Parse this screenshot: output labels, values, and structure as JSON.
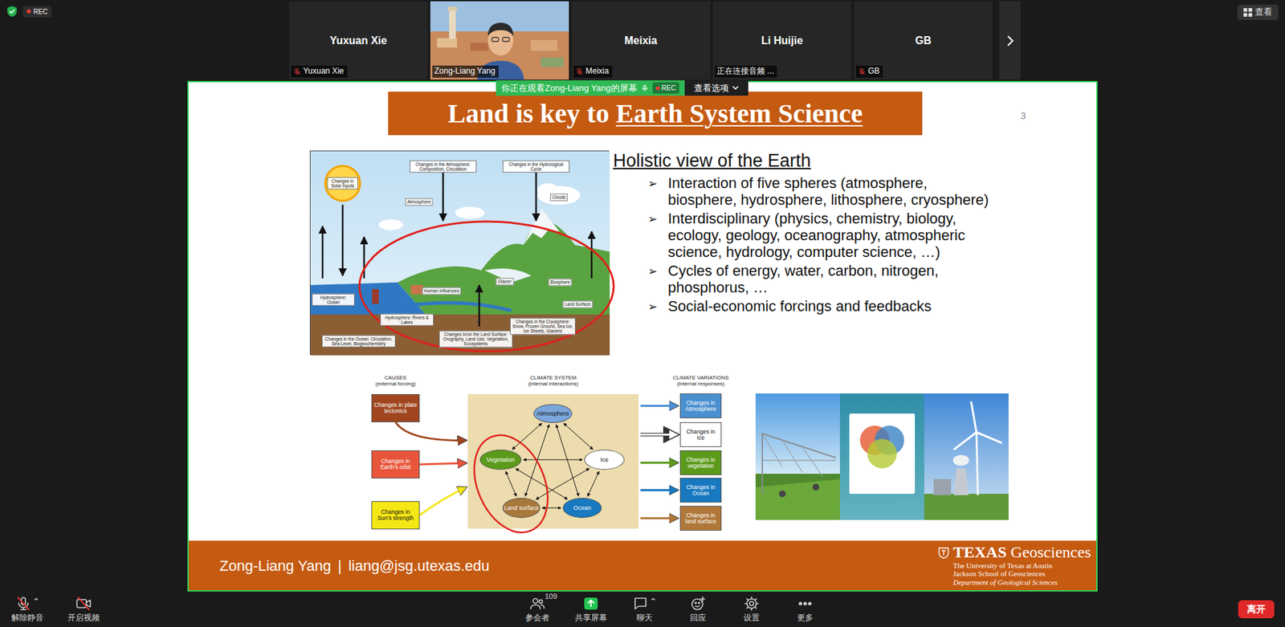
{
  "meeting": {
    "recording": "REC",
    "view_button": "查看"
  },
  "participants": [
    {
      "kind": "avatar",
      "name": "Yuxuan Xie",
      "label": "Yuxuan Xie",
      "muted": true,
      "speaking": false
    },
    {
      "kind": "video",
      "label": "Zong-Liang Yang",
      "muted": false,
      "speaking": true
    },
    {
      "kind": "avatar",
      "name": "Meixia",
      "label": "Meixia",
      "muted": true,
      "speaking": false
    },
    {
      "kind": "avatar",
      "name": "Li Huijie",
      "label": "正在连接音频 ...",
      "muted": false,
      "speaking": false
    },
    {
      "kind": "avatar",
      "name": "GB",
      "label": "GB",
      "muted": true,
      "speaking": false
    }
  ],
  "share_banner": {
    "text": "你正在观看Zong-Liang Yang的屏幕",
    "recording": "REC",
    "options": "查看选项"
  },
  "slide": {
    "title": "Land is key to",
    "title_link": "Earth System Science",
    "page": "3",
    "figure_labels": [
      "Changes in Solar Inputs",
      "Changes in the Atmosphere: Composition, Circulation",
      "Changes in the Hydrological Cycle",
      "Atmosphere",
      "Clouds",
      "Human Influences",
      "Glacier",
      "Biosphere",
      "Land Surface",
      "Hydrosphere: Ocean",
      "Hydrosphere: Rivers & Lakes",
      "Changes in the Ocean: Circulation, Sea Level, Biogeochemistry",
      "Changes in/on the Land Surface: Orography, Land Use, Vegetation, Ecosystems",
      "Changes in the Cryosphere: Snow, Frozen Ground, Sea Ice, Ice Sheets, Glaciers"
    ],
    "heading": "Holistic view of the Earth",
    "bullet_marker": "➢",
    "bullets": [
      "Interaction of five spheres (atmosphere, biosphere, hydrosphere, lithosphere, cryosphere)",
      "Interdisciplinary (physics, chemistry, biology, ecology, geology, oceanography, atmospheric science, hydrology, computer science, …)",
      "Cycles of energy, water, carbon, nitrogen, phosphorus, …",
      "Social-economic forcings and feedbacks"
    ]
  },
  "climate": {
    "causes_title": "CAUSES",
    "causes_subtitle": "(external forcing)",
    "causes": [
      {
        "label": "Changes in plate tectonics",
        "color": "#a0461f"
      },
      {
        "label": "Changes in Earth's orbit",
        "color": "#e8553a"
      },
      {
        "label": "Changes in Sun's strength",
        "color": "#f5e616"
      }
    ],
    "system_title": "CLIMATE SYSTEM",
    "system_subtitle": "(internal interactions)",
    "components": [
      {
        "label": "Atmosphere",
        "color": "#7aa6dc"
      },
      {
        "label": "Vegetation",
        "color": "#5c9a1b"
      },
      {
        "label": "Ice",
        "color": "#ffffff"
      },
      {
        "label": "Land surface",
        "color": "#a8773a"
      },
      {
        "label": "Ocean",
        "color": "#1878c0"
      }
    ],
    "variations_title": "CLIMATE VARIATIONS",
    "variations_subtitle": "(internal responses)",
    "variations": [
      {
        "label": "Changes in Atmosphere",
        "color": "#4a90d0"
      },
      {
        "label": "Changes in Ice",
        "color": "#ffffff"
      },
      {
        "label": "Changes in vegetation",
        "color": "#5c9a1b"
      },
      {
        "label": "Changes in Ocean",
        "color": "#1878c0"
      },
      {
        "label": "Changes in land surface",
        "color": "#b0773a"
      }
    ]
  },
  "footer": {
    "author": "Zong-Liang Yang",
    "separator": "|",
    "email": "liang@jsg.utexas.edu",
    "logo_bold": "TEXAS",
    "logo_rest": "Geosciences",
    "org_lines": [
      "The University of Texas at Austin",
      "Jackson School of Geosciences",
      "Department of Geological Sciences"
    ]
  },
  "toolbar": {
    "left": [
      {
        "kind": "mic",
        "label": "解除静音",
        "off": true,
        "caret": true
      },
      {
        "kind": "camera",
        "label": "开启视频",
        "off": true,
        "caret": false
      }
    ],
    "center": [
      {
        "kind": "participants",
        "label": "参会者",
        "count": "109",
        "caret": false
      },
      {
        "kind": "share",
        "label": "共享屏幕",
        "caret": false
      },
      {
        "kind": "chat",
        "label": "聊天",
        "caret": true
      },
      {
        "kind": "reactions",
        "label": "回应",
        "caret": false
      },
      {
        "kind": "settings",
        "label": "设置",
        "caret": false
      },
      {
        "kind": "more",
        "label": "更多",
        "caret": false
      }
    ],
    "leave": "离开"
  }
}
